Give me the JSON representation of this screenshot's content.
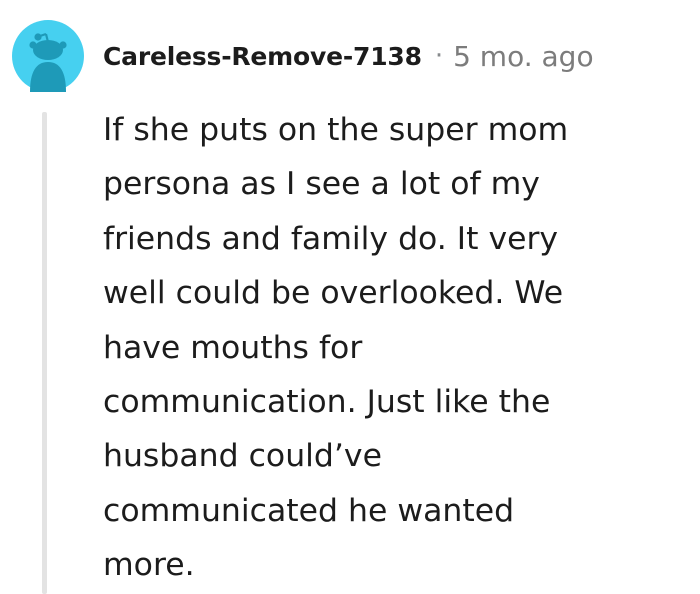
{
  "comment": {
    "username": "Careless-Remove-7138",
    "separator": "·",
    "timestamp": "5 mo. ago",
    "body_lines": [
      "If she puts on the super mom",
      "persona as I see a lot of my",
      "friends and family do. It very",
      "well could be overlooked. We",
      "have mouths for",
      "communication. Just like the",
      "husband could’ve",
      "communicated he wanted",
      "more."
    ]
  },
  "colors": {
    "avatar_background": "#46D0F0",
    "avatar_figure": "#1E9AB8",
    "username_text": "#1C1C1C",
    "timestamp_text": "#7C7C7C",
    "body_text": "#1C1C1C",
    "thread_line": "#E3E3E3"
  },
  "icons": {
    "avatar": "reddit-snoo-avatar-icon"
  }
}
